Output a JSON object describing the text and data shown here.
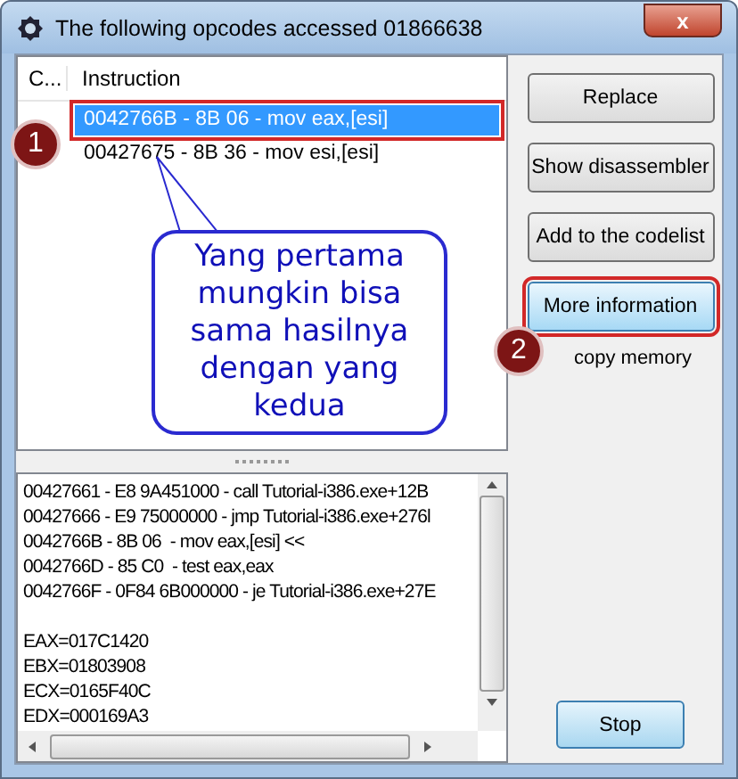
{
  "window": {
    "title": "The following opcodes accessed 01866638",
    "close": "x"
  },
  "list": {
    "columns": [
      "C...",
      "Instruction"
    ],
    "rows": [
      {
        "instruction": "0042766B - 8B 06  - mov eax,[esi]",
        "selected": true,
        "outlined": true
      },
      {
        "instruction": "00427675 - 8B 36  - mov esi,[esi]",
        "selected": false,
        "outlined": false
      }
    ]
  },
  "buttons": [
    {
      "label": "Replace",
      "highlighted": false,
      "outlined": false
    },
    {
      "label": "Show disassembler",
      "highlighted": false,
      "outlined": false
    },
    {
      "label": "Add to the codelist",
      "highlighted": false,
      "outlined": false
    },
    {
      "label": "More information",
      "highlighted": true,
      "outlined": true
    }
  ],
  "side_label": "copy memory",
  "memo": {
    "code": [
      "00427661 - E8 9A451000 - call Tutorial-i386.exe+12B",
      "00427666 - E9 75000000 - jmp Tutorial-i386.exe+276l",
      "0042766B - 8B 06  - mov eax,[esi] <<",
      "0042766D - 85 C0  - test eax,eax",
      "0042766F - 0F84 6B000000 - je Tutorial-i386.exe+27E"
    ],
    "registers": [
      "EAX=017C1420",
      "EBX=01803908",
      "ECX=0165F40C",
      "EDX=000169A3"
    ]
  },
  "stop_button": {
    "label": "Stop"
  },
  "annotations": {
    "markers": [
      "1",
      "2"
    ],
    "callout": "Yang pertama mungkin bisa sama hasilnya dengan yang kedua"
  }
}
